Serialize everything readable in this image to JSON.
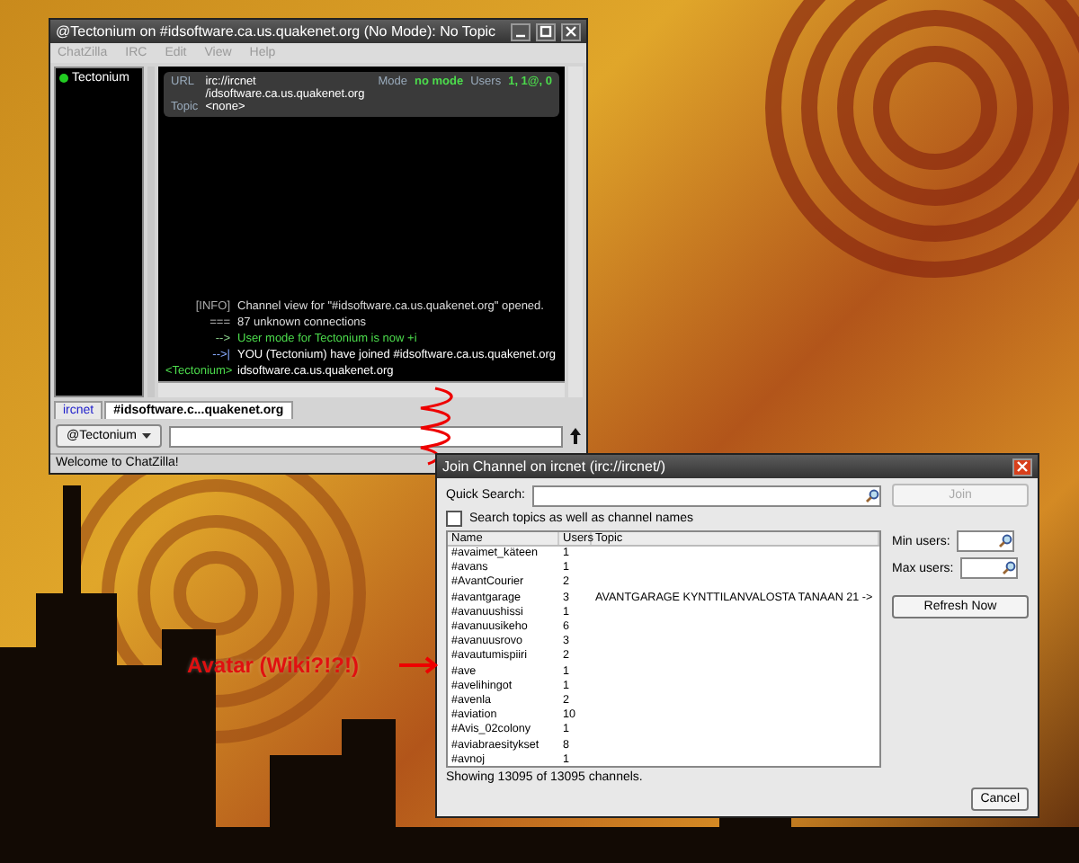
{
  "chat_window": {
    "title": "@Tectonium on #idsoftware.ca.us.quakenet.org (No Mode): No Topic",
    "menu": [
      {
        "label": "ChatZilla",
        "disabled": true
      },
      {
        "label": "IRC",
        "disabled": true
      },
      {
        "label": "Edit",
        "disabled": true
      },
      {
        "label": "View",
        "disabled": true
      },
      {
        "label": "Help",
        "disabled": true
      }
    ],
    "userlist": [
      {
        "name": "Tectonium",
        "color": "#22cc22"
      }
    ],
    "header": {
      "url_label": "URL",
      "url": "irc://ircnet /idsoftware.ca.us.quakenet.org",
      "mode_label": "Mode",
      "mode": "no mode",
      "users_label": "Users",
      "users": "1, 1@, 0",
      "topic_label": "Topic",
      "topic": "<none>"
    },
    "messages": [
      {
        "prefix": "[INFO]",
        "text": "Channel view for \"#idsoftware.ca.us.quakenet.org\" opened.",
        "kind": "info"
      },
      {
        "prefix": "===",
        "text": "87 unknown connections",
        "kind": "notice"
      },
      {
        "prefix": "-->",
        "text": "User mode for Tectonium is now +i",
        "kind": "mode"
      },
      {
        "prefix": "-->|",
        "text": "YOU (Tectonium) have joined #idsoftware.ca.us.quakenet.org",
        "kind": "join"
      },
      {
        "prefix": "<Tectonium>",
        "text": "idsoftware.ca.us.quakenet.org",
        "kind": "self"
      }
    ],
    "tabs": [
      {
        "label": "ircnet",
        "selected": false
      },
      {
        "label": "#idsoftware.c...quakenet.org",
        "selected": true
      }
    ],
    "nick_button": "@Tectonium",
    "status": "Welcome to ChatZilla!"
  },
  "join_dialog": {
    "title": "Join Channel on ircnet (irc://ircnet/)",
    "quick_search_label": "Quick Search:",
    "join_button": {
      "label": "Join",
      "disabled": true
    },
    "search_topics": {
      "label": "Search topics as well as channel names",
      "checked": false
    },
    "columns": [
      "Name",
      "Users",
      "Topic"
    ],
    "rows": [
      {
        "name": "#avaimet_käteen",
        "users": "1",
        "topic": ""
      },
      {
        "name": "#avans",
        "users": "1",
        "topic": ""
      },
      {
        "name": "#AvantCourier",
        "users": "2",
        "topic": ""
      },
      {
        "name": "#avantgarage",
        "users": "3",
        "topic": "AVANTGARAGE KYNTTILANVALOSTA TANAAN 21 ->"
      },
      {
        "name": "#avanuushissi",
        "users": "1",
        "topic": ""
      },
      {
        "name": "#avanuusikeho",
        "users": "6",
        "topic": ""
      },
      {
        "name": "#avanuusrovo",
        "users": "3",
        "topic": ""
      },
      {
        "name": "#avautumispiiri",
        "users": "2",
        "topic": ""
      },
      {
        "name": "#ave",
        "users": "1",
        "topic": ""
      },
      {
        "name": "#avelihingot",
        "users": "1",
        "topic": ""
      },
      {
        "name": "#avenla",
        "users": "2",
        "topic": ""
      },
      {
        "name": "#aviation",
        "users": "10",
        "topic": ""
      },
      {
        "name": "#Avis_02colony",
        "users": "1",
        "topic": ""
      },
      {
        "name": "#aviabraesitykset",
        "users": "8",
        "topic": ""
      },
      {
        "name": "#avnoj",
        "users": "1",
        "topic": ""
      }
    ],
    "min_users_label": "Min users:",
    "max_users_label": "Max users:",
    "refresh_button": "Refresh Now",
    "count": "Showing 13095 of 13095 channels.",
    "cancel_button": "Cancel"
  },
  "annotation": "Avatar (Wiki?!?!)"
}
